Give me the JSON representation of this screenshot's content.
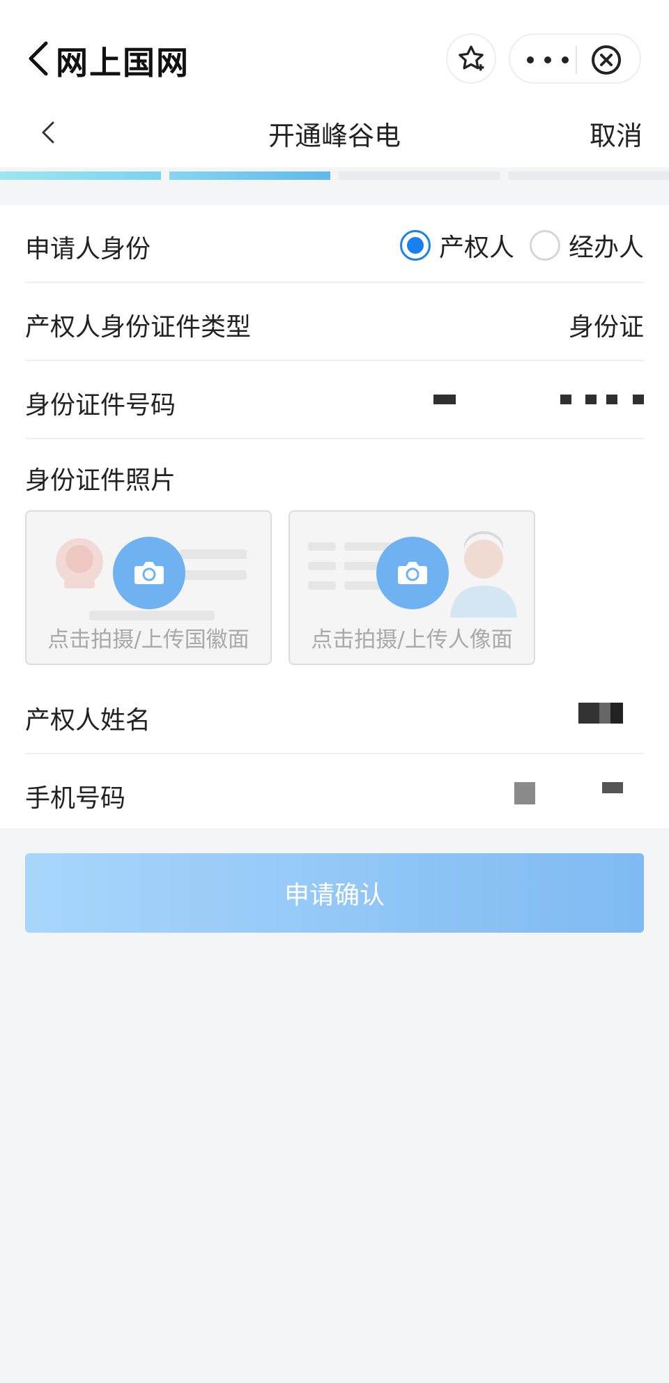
{
  "mini_program": {
    "title": "网上国网"
  },
  "nav": {
    "title": "开通峰谷电",
    "cancel": "取消"
  },
  "steps": {
    "total": 4,
    "completed": 2
  },
  "form": {
    "applicant_identity": {
      "label": "申请人身份",
      "options": [
        "产权人",
        "经办人"
      ],
      "selected": "产权人"
    },
    "id_type": {
      "label": "产权人身份证件类型",
      "value": "身份证"
    },
    "id_number": {
      "label": "身份证件号码"
    },
    "id_photo": {
      "label": "身份证件照片",
      "front_text": "点击拍摄/上传国徽面",
      "back_text": "点击拍摄/上传人像面"
    },
    "owner_name": {
      "label": "产权人姓名"
    },
    "phone": {
      "label": "手机号码"
    }
  },
  "submit": {
    "label": "申请确认"
  },
  "colors": {
    "accent": "#1a7ff0",
    "button": "#8cc4f5",
    "camera": "#6fb2f1",
    "step_done": "#7bd3ef"
  }
}
